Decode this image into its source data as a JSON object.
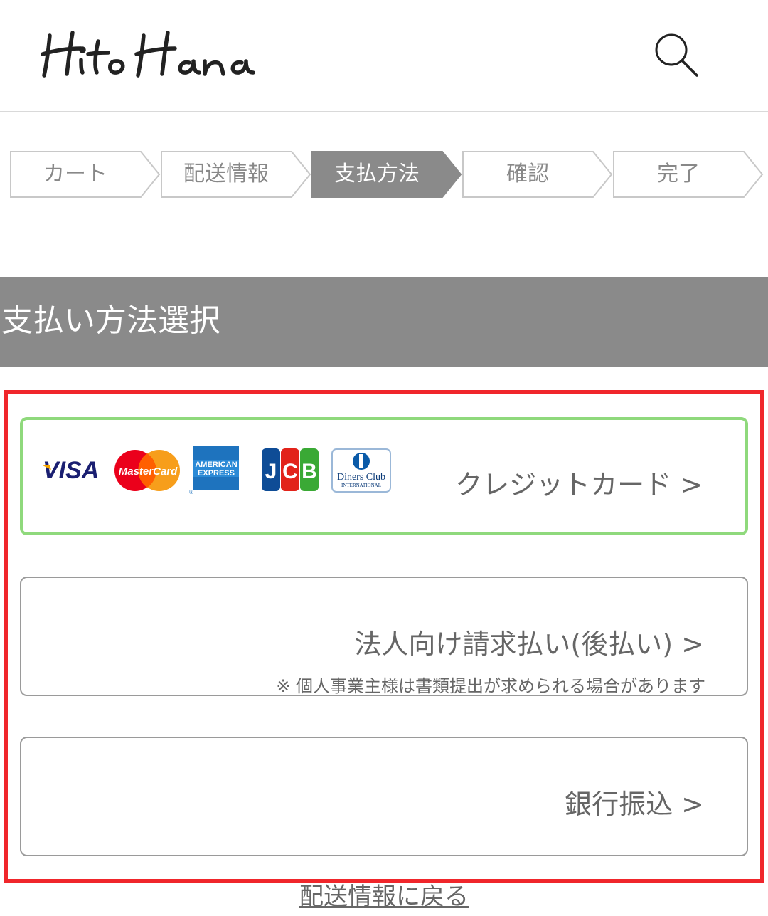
{
  "header": {
    "logo_text": "HitoHana",
    "search_icon": "search-icon"
  },
  "steps": [
    {
      "label": "カート",
      "active": false
    },
    {
      "label": "配送情報",
      "active": false
    },
    {
      "label": "支払方法",
      "active": true
    },
    {
      "label": "確認",
      "active": false
    },
    {
      "label": "完了",
      "active": false
    }
  ],
  "section": {
    "title": "支払い方法選択"
  },
  "options": {
    "credit": {
      "label": "クレジットカード >",
      "brands": [
        "VISA",
        "MasterCard",
        "AMERICAN EXPRESS",
        "JCB",
        "Diners Club INTERNATIONAL"
      ]
    },
    "invoice": {
      "label": "法人向け請求払い(後払い) >",
      "note": "※ 個人事業主様は書類提出が求められる場合があります"
    },
    "bank": {
      "label": "銀行振込 >"
    }
  },
  "footer": {
    "back_link": "配送情報に戻る"
  },
  "colors": {
    "step_active": "#8a8a8a",
    "step_border": "#c8c8c8",
    "section_bar": "#8a8a8a",
    "highlight_frame": "#f0262b",
    "credit_border": "#8fd97c"
  }
}
